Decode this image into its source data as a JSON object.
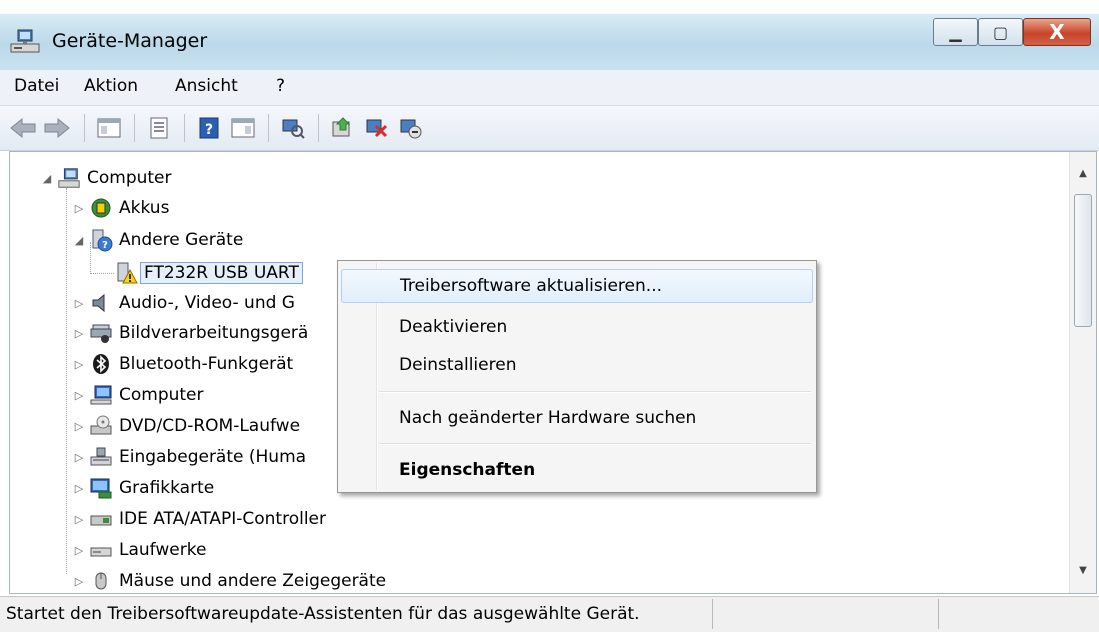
{
  "window": {
    "title": "Geräte-Manager",
    "buttons": {
      "minimize": "▁",
      "maximize": "▢",
      "close": "X"
    },
    "colors": {
      "title_bar": "#c4def0",
      "close_button": "#c8452a"
    }
  },
  "menubar": {
    "items": [
      "Datei",
      "Aktion",
      "Ansicht",
      "?"
    ]
  },
  "toolbar": {
    "icons": [
      "back-arrow-icon",
      "forward-arrow-icon",
      "show-hide-console-tree-icon",
      "properties-icon",
      "help-icon",
      "action-pane-icon",
      "scan-hardware-icon",
      "update-driver-icon",
      "disable-device-icon",
      "uninstall-device-icon"
    ]
  },
  "tree": {
    "root": {
      "label": "Computer",
      "expanded": true,
      "icon": "computer-icon"
    },
    "items": [
      {
        "label": "Akkus",
        "icon": "battery-icon",
        "expanded": false
      },
      {
        "label": "Andere Geräte",
        "icon": "unknown-device-icon",
        "expanded": true
      },
      {
        "label": "FT232R USB UART",
        "icon": "warning-device-icon",
        "selected": true
      },
      {
        "label": "Audio-, Video- und G",
        "icon": "audio-icon",
        "expanded": false
      },
      {
        "label": "Bildverarbeitungsgerä",
        "icon": "imaging-device-icon",
        "expanded": false
      },
      {
        "label": "Bluetooth-Funkgerät",
        "icon": "bluetooth-icon",
        "expanded": false
      },
      {
        "label": "Computer",
        "icon": "computer-icon",
        "expanded": false
      },
      {
        "label": "DVD/CD-ROM-Laufwe",
        "icon": "dvd-drive-icon",
        "expanded": false
      },
      {
        "label": "Eingabegeräte (Huma",
        "icon": "input-device-icon",
        "expanded": false
      },
      {
        "label": "Grafikkarte",
        "icon": "display-adapter-icon",
        "expanded": false
      },
      {
        "label": "IDE ATA/ATAPI-Controller",
        "icon": "ide-controller-icon",
        "expanded": false
      },
      {
        "label": "Laufwerke",
        "icon": "disk-drive-icon",
        "expanded": false
      },
      {
        "label": "Mäuse und andere Zeigegeräte",
        "icon": "mouse-icon",
        "expanded": false
      }
    ]
  },
  "context_menu": {
    "items": [
      {
        "label": "Treibersoftware aktualisieren...",
        "highlighted": true
      },
      {
        "label": "Deaktivieren"
      },
      {
        "label": "Deinstallieren"
      },
      {
        "label": "Nach geänderter Hardware suchen"
      },
      {
        "label": "Eigenschaften",
        "bold": true
      }
    ]
  },
  "statusbar": {
    "text": "Startet den Treibersoftwareupdate-Assistenten für das ausgewählte Gerät."
  }
}
